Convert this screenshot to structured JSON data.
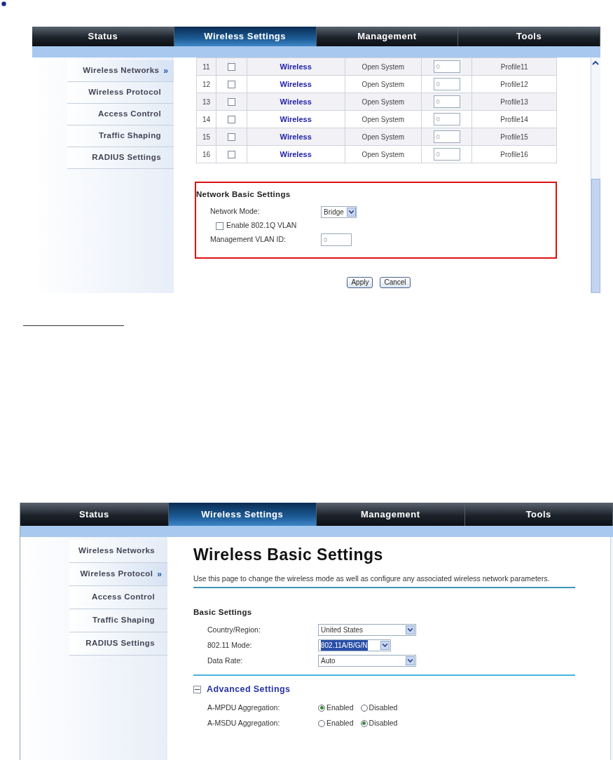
{
  "screens": [
    {
      "kind": "profiles",
      "tabs": [
        {
          "label": "Status",
          "selected": false
        },
        {
          "label": "Wireless Settings",
          "selected": true
        },
        {
          "label": "Management",
          "selected": false
        },
        {
          "label": "Tools",
          "selected": false
        }
      ],
      "marker": "»",
      "sidebar": [
        {
          "label": "Wireless Networks",
          "selected": true
        },
        {
          "label": "Wireless Protocol",
          "selected": false
        },
        {
          "label": "Access Control",
          "selected": false
        },
        {
          "label": "Traffic Shaping",
          "selected": false
        },
        {
          "label": "RADIUS Settings",
          "selected": false
        }
      ],
      "rows": [
        {
          "index": "11",
          "checked": false,
          "name": "Wireless",
          "security": "Open System",
          "vlan": "0",
          "profile": "Profile11"
        },
        {
          "index": "12",
          "checked": false,
          "name": "Wireless",
          "security": "Open System",
          "vlan": "0",
          "profile": "Profile12"
        },
        {
          "index": "13",
          "checked": false,
          "name": "Wireless",
          "security": "Open System",
          "vlan": "0",
          "profile": "Profile13"
        },
        {
          "index": "14",
          "checked": false,
          "name": "Wireless",
          "security": "Open System",
          "vlan": "0",
          "profile": "Profile14"
        },
        {
          "index": "15",
          "checked": false,
          "name": "Wireless",
          "security": "Open System",
          "vlan": "0",
          "profile": "Profile15"
        },
        {
          "index": "16",
          "checked": false,
          "name": "Wireless",
          "security": "Open System",
          "vlan": "0",
          "profile": "Profile16"
        }
      ],
      "section": {
        "title": "Network Basic Settings",
        "mode_label": "Network Mode:",
        "mode_value": "Bridge",
        "vlan_checkbox": {
          "label": "Enable 802.1Q VLAN",
          "checked": false
        },
        "vlan_id_label": "Management VLAN ID:",
        "vlan_id_value": "0"
      },
      "buttons": [
        "Apply",
        "Cancel"
      ]
    },
    {
      "kind": "basic",
      "tabs": [
        {
          "label": "Status",
          "selected": false
        },
        {
          "label": "Wireless Settings",
          "selected": true
        },
        {
          "label": "Management",
          "selected": false
        },
        {
          "label": "Tools",
          "selected": false
        }
      ],
      "marker": "»",
      "sidebar": [
        {
          "label": "Wireless Networks",
          "selected": false
        },
        {
          "label": "Wireless Protocol",
          "selected": true
        },
        {
          "label": "Access Control",
          "selected": false
        },
        {
          "label": "Traffic Shaping",
          "selected": false
        },
        {
          "label": "RADIUS Settings",
          "selected": false
        }
      ],
      "title": "Wireless Basic Settings",
      "description": "Use this page to change the wireless mode as well as configure any associated wireless network parameters.",
      "basic": {
        "title": "Basic Settings",
        "fields": [
          {
            "label": "Country/Region:",
            "value": "United States",
            "highlighted": false
          },
          {
            "label": "802.11 Mode:",
            "value": "802.11A/B/G/N",
            "highlighted": true
          },
          {
            "label": "Data Rate:",
            "value": "Auto",
            "highlighted": false
          }
        ]
      },
      "advanced": {
        "title": "Advanced Settings",
        "expanded": true,
        "fields": [
          {
            "label": "A-MPDU Aggregation:",
            "options": [
              {
                "label": "Enabled",
                "selected": true
              },
              {
                "label": "Disabled",
                "selected": false
              }
            ]
          },
          {
            "label": "A-MSDU Aggregation:",
            "options": [
              {
                "label": "Enabled",
                "selected": false
              },
              {
                "label": "Disabled",
                "selected": true
              }
            ]
          }
        ]
      }
    }
  ]
}
